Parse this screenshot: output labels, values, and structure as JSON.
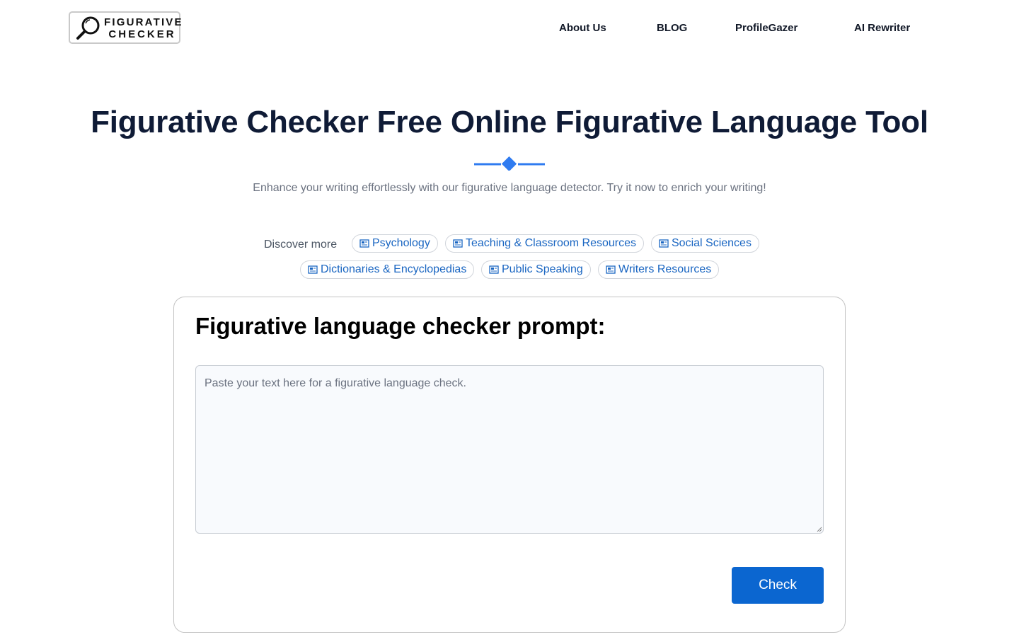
{
  "header": {
    "logo": {
      "line1": "FIGURATIVE",
      "line2": "CHECKER",
      "icon": "magnifier-icon"
    },
    "nav": [
      {
        "label": "About Us"
      },
      {
        "label": "BLOG"
      },
      {
        "label": "ProfileGazer"
      },
      {
        "label": "AI Rewriter"
      }
    ]
  },
  "hero": {
    "title": "Figurative Checker Free Online Figurative Language Tool",
    "subtitle": "Enhance your writing effortlessly with our figurative language detector. Try it now to enrich your writing!",
    "divider_color": "#2f7bf0"
  },
  "discover": {
    "label": "Discover more",
    "chip_icon": "newspaper-icon",
    "chips": [
      {
        "label": "Psychology"
      },
      {
        "label": "Teaching & Classroom Resources"
      },
      {
        "label": "Social Sciences"
      },
      {
        "label": "Dictionaries & Encyclopedias"
      },
      {
        "label": "Public Speaking"
      },
      {
        "label": "Writers Resources"
      }
    ]
  },
  "checker": {
    "heading": "Figurative language checker prompt:",
    "textarea_value": "",
    "textarea_placeholder": "Paste your text here for a figurative language check.",
    "button_label": "Check",
    "button_color": "#0b66d0"
  }
}
